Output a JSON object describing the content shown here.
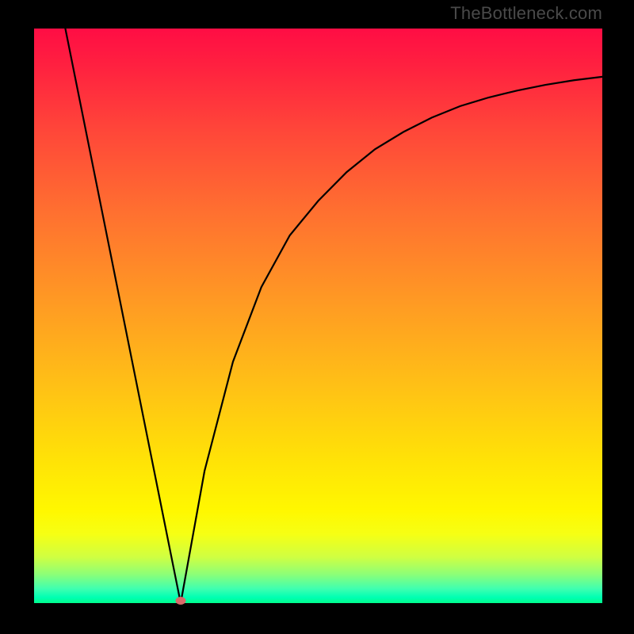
{
  "watermark": "TheBottleneck.com",
  "colors": {
    "frame": "#000000",
    "curve": "#000000",
    "marker": "#d86a6a",
    "gradient_top": "#ff0d44",
    "gradient_bottom": "#00fe8c"
  },
  "chart_data": {
    "type": "line",
    "title": "",
    "xlabel": "",
    "ylabel": "",
    "xlim": [
      0,
      100
    ],
    "ylim": [
      0,
      100
    ],
    "left_branch": {
      "comment": "approx. straight descent from top-left to vertex",
      "x": [
        5.5,
        25.8
      ],
      "y": [
        100,
        0
      ]
    },
    "right_branch": {
      "comment": "concave rise from vertex towards upper-right, flattening",
      "x": [
        25.8,
        30,
        35,
        40,
        45,
        50,
        55,
        60,
        65,
        70,
        75,
        80,
        85,
        90,
        95,
        100
      ],
      "y": [
        0,
        23,
        42,
        55,
        64,
        70,
        75,
        79,
        82,
        84.5,
        86.5,
        88,
        89.2,
        90.2,
        91,
        91.6
      ]
    },
    "vertex_marker": {
      "x": 25.8,
      "y": 0
    },
    "annotations": []
  }
}
